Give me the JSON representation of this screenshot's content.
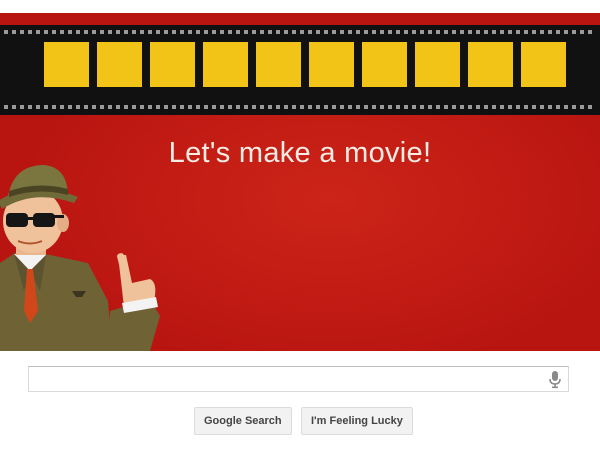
{
  "doodle": {
    "headline": "Let's make a movie!",
    "frame_count": 10,
    "colors": {
      "background": "#c3170f",
      "film": "#111111",
      "frames": "#f2c418"
    }
  },
  "search": {
    "value": "",
    "placeholder": "",
    "mic_icon": "microphone-icon"
  },
  "buttons": {
    "search": "Google Search",
    "lucky": "I'm Feeling Lucky"
  }
}
